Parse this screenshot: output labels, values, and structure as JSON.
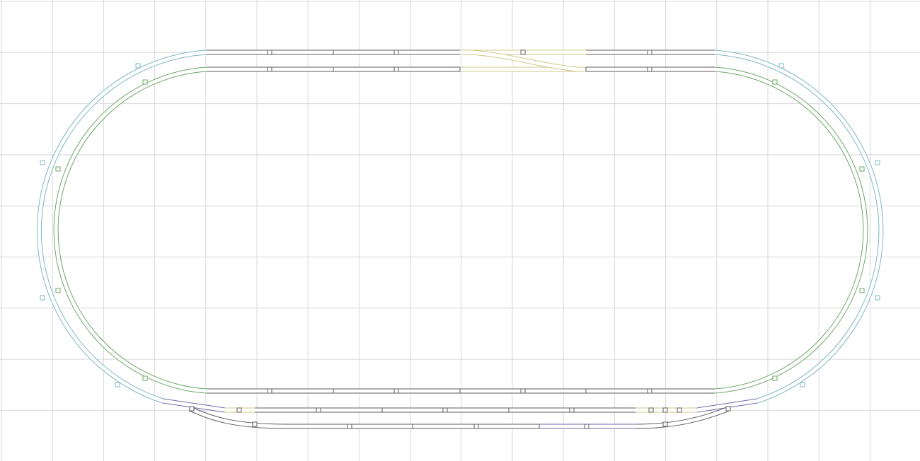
{
  "diagram": {
    "kind": "model railway track plan",
    "grid": true,
    "colors": {
      "background": "#ffffff",
      "grid": "#d8d8d8",
      "outer_loop": "#7fb6c4",
      "inner_loop": "#6aa864",
      "straight_track": "#5c5c5c",
      "turnout": "#cfc98a",
      "siding": "#6f6aa8"
    },
    "elements": [
      {
        "type": "loop",
        "name": "outer-loop",
        "color_key": "outer_loop"
      },
      {
        "type": "loop",
        "name": "inner-loop",
        "color_key": "inner_loop"
      },
      {
        "type": "turnout",
        "name": "top-crossover",
        "color_key": "turnout"
      },
      {
        "type": "yard",
        "name": "bottom-siding",
        "color_key": "siding"
      }
    ]
  }
}
